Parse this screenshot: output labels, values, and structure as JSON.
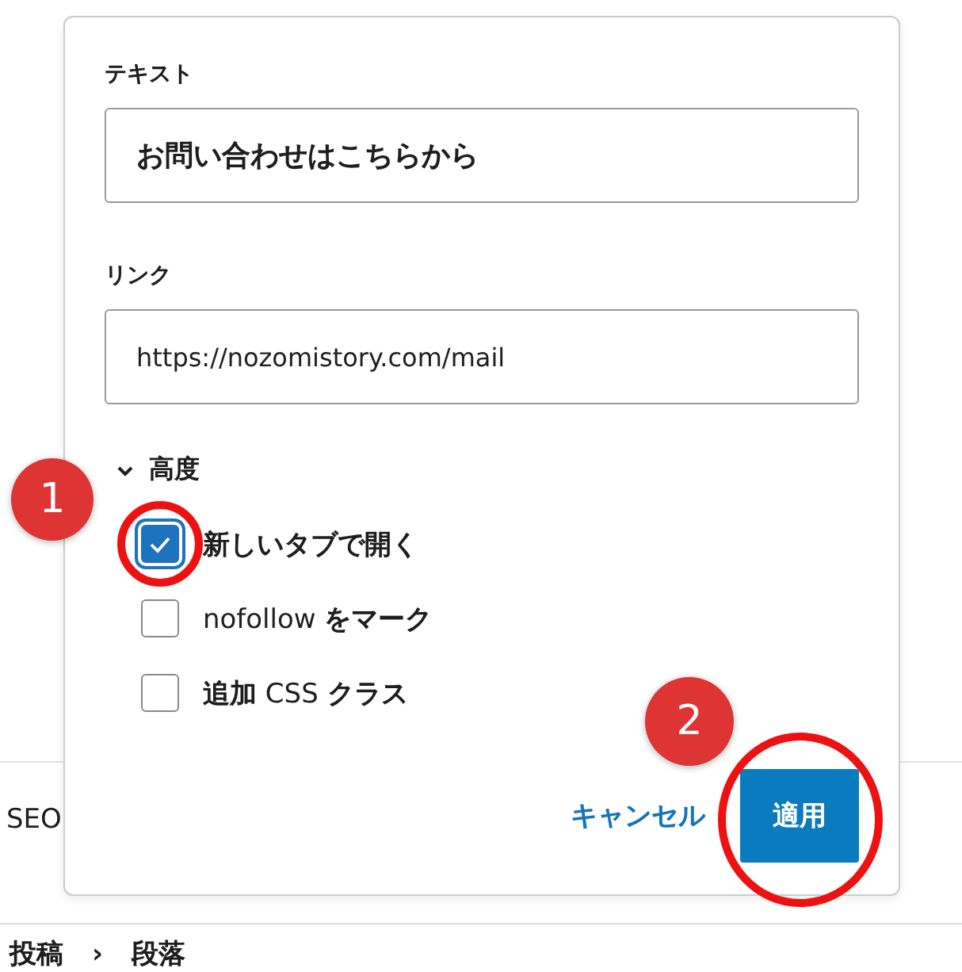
{
  "background": {
    "section_label": "SEO",
    "breadcrumb": [
      {
        "label": "投稿"
      },
      {
        "label": "段落"
      }
    ],
    "breadcrumb_separator": "›"
  },
  "popup": {
    "text_field": {
      "label": "テキスト",
      "value": "お問い合わせはこちらから"
    },
    "link_field": {
      "label": "リンク",
      "value": "https://nozomistory.com/mail"
    },
    "advanced": {
      "label": "高度",
      "expanded": true,
      "options": [
        {
          "label": "**新しいタブで開く**",
          "checked": true,
          "annotation": "1"
        },
        {
          "label": "nofollow **をマーク**",
          "checked": false
        },
        {
          "label": "**追加** CSS **クラス**",
          "checked": false
        }
      ]
    },
    "buttons": [
      {
        "label": "キャンセル",
        "kind": "link"
      },
      {
        "label": "適用",
        "kind": "primary",
        "annotation": "2"
      }
    ]
  }
}
